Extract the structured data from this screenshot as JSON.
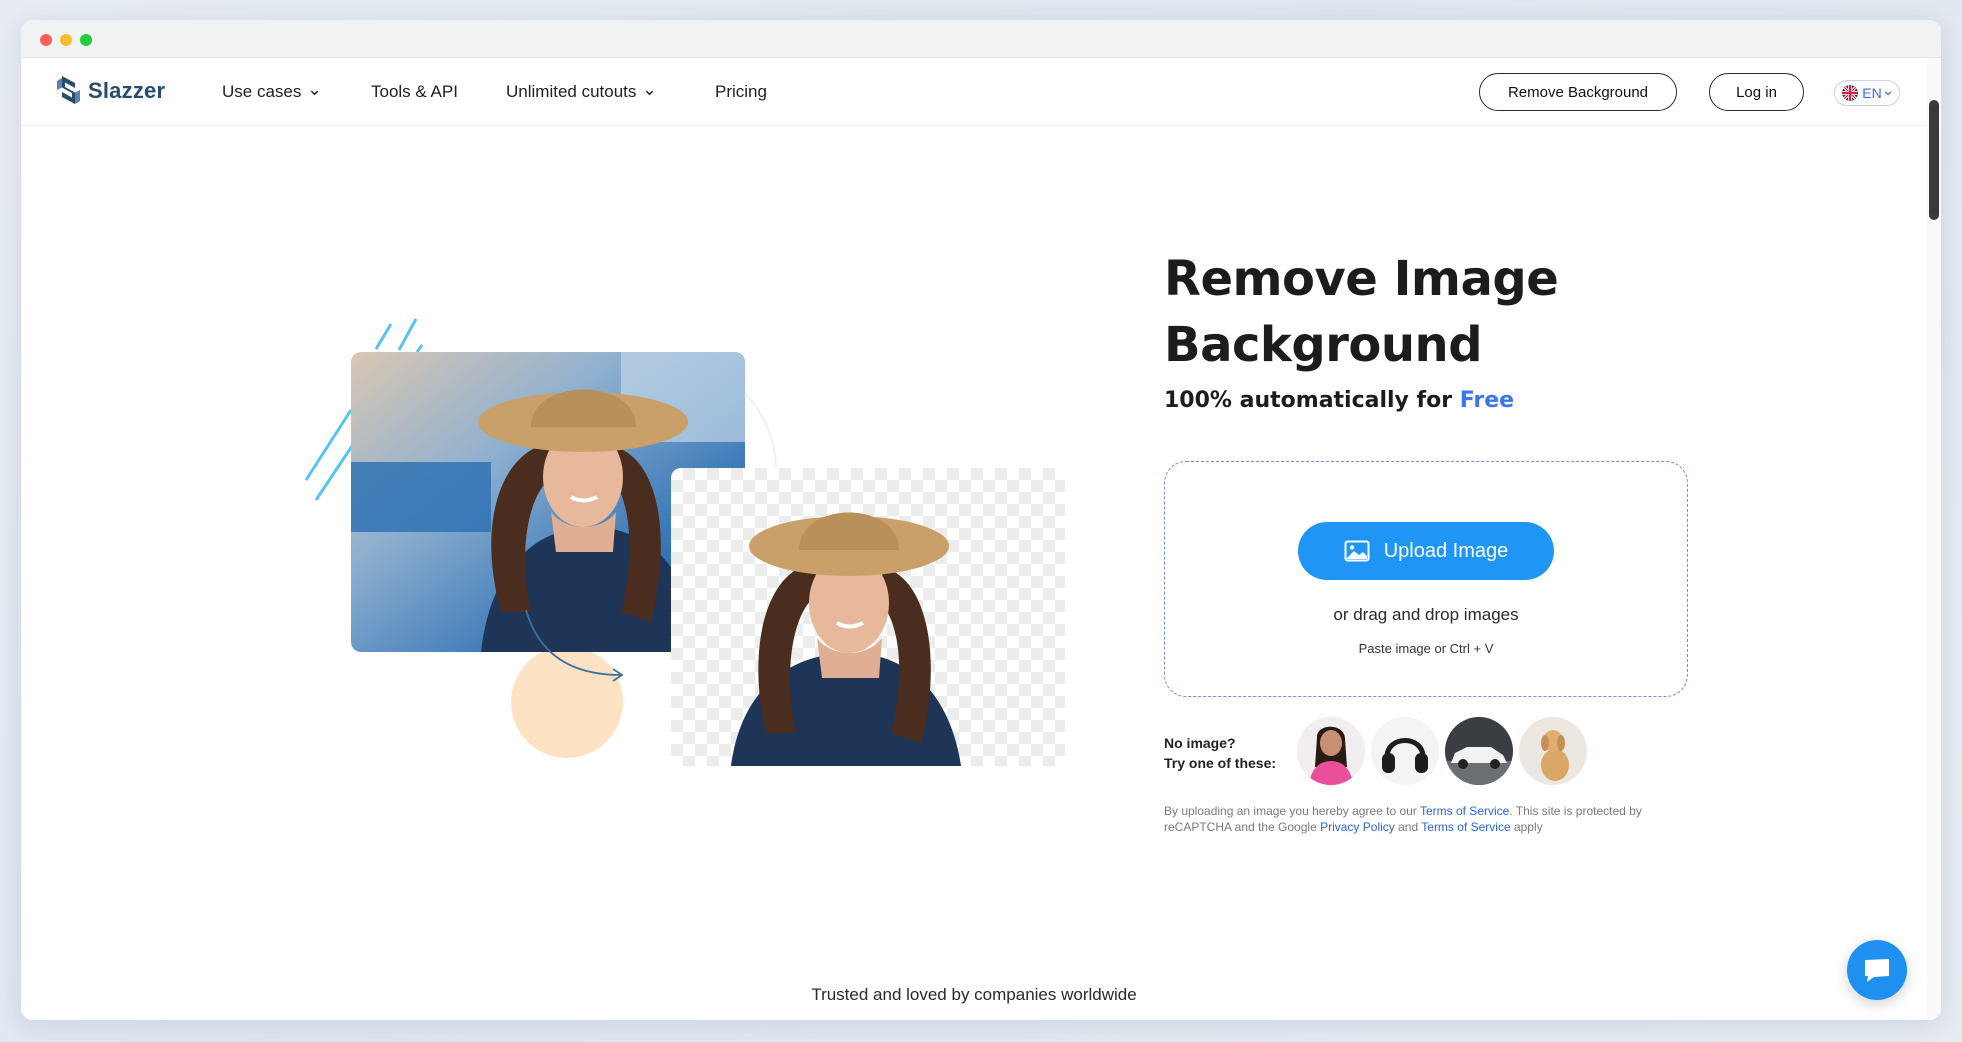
{
  "nav": {
    "brand": "Slazzer",
    "items": [
      {
        "label": "Use cases",
        "has_dropdown": true
      },
      {
        "label": "Tools & API",
        "has_dropdown": false
      },
      {
        "label": "Unlimited cutouts",
        "has_dropdown": true
      },
      {
        "label": "Pricing",
        "has_dropdown": false
      }
    ],
    "remove_bg_label": "Remove Background",
    "login_label": "Log in",
    "lang_label": "EN"
  },
  "hero": {
    "title_line1": "Remove Image",
    "title_line2": "Background",
    "subtitle_prefix": "100% automatically for ",
    "subtitle_highlight": "Free"
  },
  "upload": {
    "button_label": "Upload Image",
    "drag_text": "or drag and drop images",
    "paste_text": "Paste image or Ctrl + V"
  },
  "samples": {
    "prompt_line1": "No image?",
    "prompt_line2": "Try one of these:",
    "items": [
      "woman-sample",
      "headphones-sample",
      "car-sample",
      "dog-sample"
    ]
  },
  "disclaimer": {
    "part1": "By uploading an image you hereby agree to our ",
    "link1": "Terms of Service",
    "part2": ". This site is protected by reCAPTCHA and the Google ",
    "link2": "Privacy Policy",
    "part3": " and ",
    "link3": "Terms of Service",
    "part4": " apply"
  },
  "footer": {
    "trusted": "Trusted and loved by companies worldwide"
  },
  "colors": {
    "accent": "#1f95f5",
    "link": "#2b63e6",
    "brand": "#2a4a6e",
    "free_highlight": "#3b76f0"
  }
}
